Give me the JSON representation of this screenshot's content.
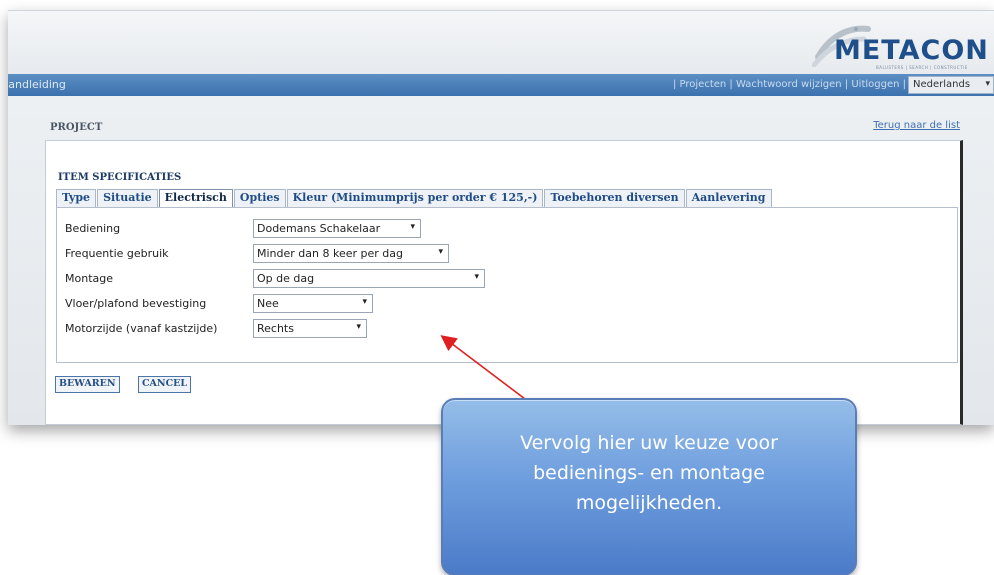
{
  "brand": {
    "logo_text": "METACON",
    "logo_subtext": "BALUSTERS | SEARCH | CONSTRUCTIE",
    "brand_color": "#1f4f8a"
  },
  "navbar": {
    "manual_link": "Handleiding",
    "links": [
      "| Projecten |",
      "Wachtwoord wijzigen |",
      "Uitloggen |"
    ],
    "language": "Nederlands",
    "bar_color": "#3b71ad"
  },
  "page": {
    "project_title": "PROJECT",
    "back_link": "Terug naar de list"
  },
  "item": {
    "title": "ITEM SPECIFICATIES",
    "tabs": [
      {
        "label": "Type",
        "active": false
      },
      {
        "label": "Situatie",
        "active": false
      },
      {
        "label": "Electrisch",
        "active": true
      },
      {
        "label": "Opties",
        "active": false
      },
      {
        "label": "Kleur (Minimumprijs per order € 125,-)",
        "active": false
      },
      {
        "label": "Toebehoren diversen",
        "active": false
      },
      {
        "label": "Aanlevering",
        "active": false
      }
    ],
    "fields": [
      {
        "label": "Bediening",
        "value": "Dodemans Schakelaar"
      },
      {
        "label": "Frequentie gebruik",
        "value": "Minder dan 8 keer per dag"
      },
      {
        "label": "Montage",
        "value": "Op de dag"
      },
      {
        "label": "Vloer/plafond bevestiging",
        "value": "Nee"
      },
      {
        "label": "Motorzijde (vanaf kastzijde)",
        "value": "Rechts"
      }
    ],
    "save_label": "BEWAREN",
    "cancel_label": "CANCEL"
  },
  "callout": {
    "text": "Vervolg hier uw keuze voor bedienings- en montage mogelijkheden.",
    "arrow_color": "#e02020"
  },
  "icons": {
    "caret": "chevron-down-icon",
    "logo_swoosh": "metacon-swoosh-icon"
  }
}
